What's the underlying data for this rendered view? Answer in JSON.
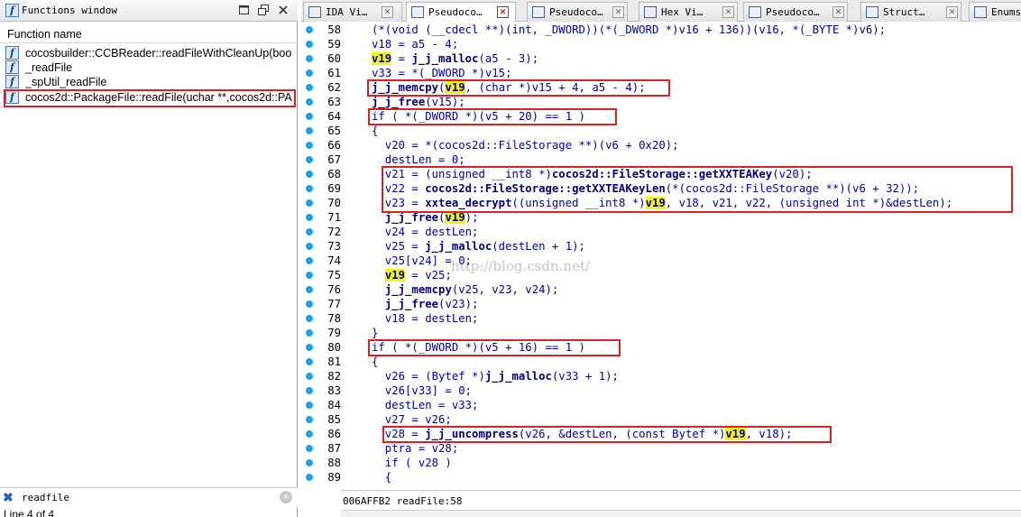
{
  "functions_window": {
    "title": "Functions window",
    "column_header": "Function name",
    "items": [
      {
        "label": "cocosbuilder::CCBReader::readFileWithCleanUp(boo",
        "icon": "function-icon"
      },
      {
        "label": "_readFile",
        "icon": "function-icon"
      },
      {
        "label": "_spUtil_readFile",
        "icon": "function-icon"
      },
      {
        "label": "cocos2d::PackageFile::readFile(uchar **,cocos2d::PA",
        "icon": "function-icon",
        "selected": true
      }
    ],
    "search_value": "readfile",
    "status": "Line 4 of 4"
  },
  "tabs": [
    {
      "label": "IDA Vi…",
      "icon": "ida-view-icon"
    },
    {
      "label": "Pseudoco…",
      "icon": "pseudocode-icon",
      "active": true
    },
    {
      "label": "Pseudoco…",
      "icon": "pseudocode-icon"
    },
    {
      "label": "Hex Vi…",
      "icon": "hex-view-icon"
    },
    {
      "label": "Pseudoco…",
      "icon": "pseudocode-icon"
    },
    {
      "label": "Struct…",
      "icon": "structures-icon"
    },
    {
      "label": "Enums",
      "icon": "enums-icon"
    }
  ],
  "code": {
    "line_numbers": [
      "58",
      "59",
      "60",
      "61",
      "62",
      "63",
      "64",
      "65",
      "66",
      "67",
      "68",
      "69",
      "70",
      "71",
      "72",
      "73",
      "74",
      "75",
      "76",
      "77",
      "78",
      "79",
      "80",
      "81",
      "82",
      "83",
      "84",
      "85",
      "86",
      "87",
      "88",
      "89"
    ],
    "lines": [
      "(*(void (__cdecl **)(int, _DWORD))(*(_DWORD *)v16 + 136))(v16, *(_BYTE *)v6);",
      "v18 = a5 - 4;",
      "v19 = j_j_malloc(a5 - 3);",
      "v33 = *(_DWORD *)v15;",
      "j_j_memcpy(v19, (char *)v15 + 4, a5 - 4);",
      "j_j_free(v15);",
      "if ( *(_DWORD *)(v5 + 20) == 1 )",
      "{",
      "  v20 = *(cocos2d::FileStorage **)(v6 + 0x20);",
      "  destLen = 0;",
      "  v21 = (unsigned __int8 *)cocos2d::FileStorage::getXXTEAKey(v20);",
      "  v22 = cocos2d::FileStorage::getXXTEAKeyLen(*(cocos2d::FileStorage **)(v6 + 32));",
      "  v23 = xxtea_decrypt((unsigned __int8 *)v19, v18, v21, v22, (unsigned int *)&destLen);",
      "  j_j_free(v19);",
      "  v24 = destLen;",
      "  v25 = j_j_malloc(destLen + 1);",
      "  v25[v24] = 0;",
      "  v19 = v25;",
      "  j_j_memcpy(v25, v23, v24);",
      "  j_j_free(v23);",
      "  v18 = destLen;",
      "}",
      "if ( *(_DWORD *)(v5 + 16) == 1 )",
      "{",
      "  v26 = (Bytef *)j_j_malloc(v33 + 1);",
      "  v26[v33] = 0;",
      "  destLen = v33;",
      "  v27 = v26;",
      "  v28 = j_j_uncompress(v26, &destLen, (const Bytef *)v19, v18);",
      "  ptra = v28;",
      "  if ( v28 )",
      "  {"
    ],
    "highlighted_var": "v19",
    "watermark": "http://blog.csdn.net/",
    "status": "006AFFB2 readFile:58"
  },
  "colors": {
    "annotation_red": "#e02020",
    "keyword_blue": "#00009f",
    "highlight_yellow": "#f6f600",
    "breakpoint_dot": "#1aa2e8"
  }
}
